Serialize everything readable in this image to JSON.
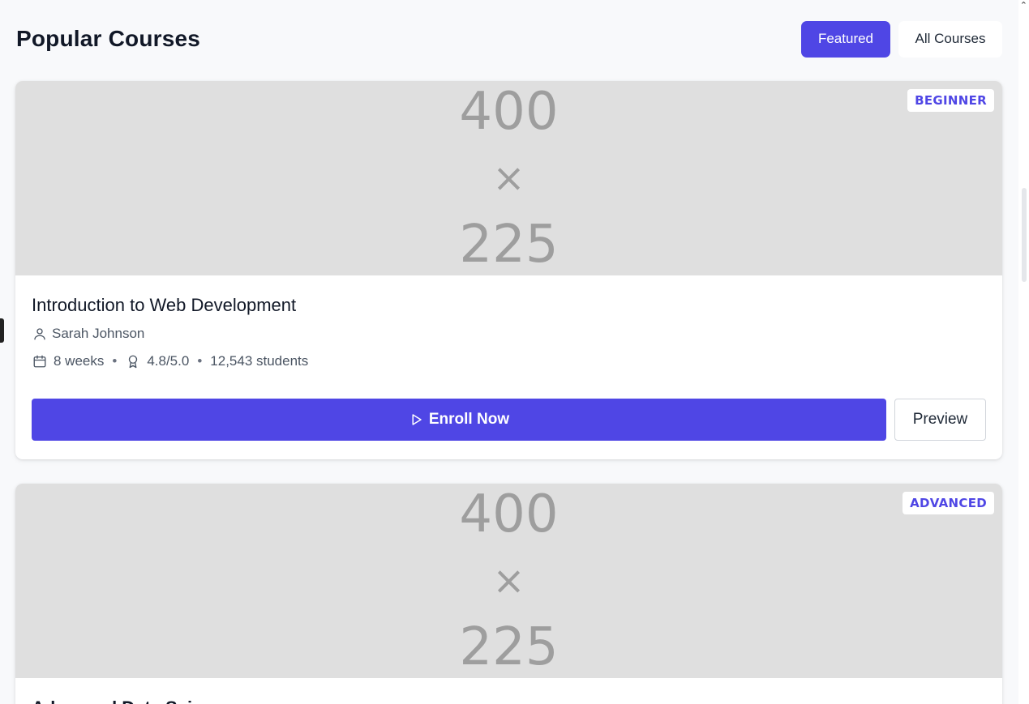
{
  "header": {
    "title": "Popular Courses",
    "filters": [
      {
        "label": "Featured",
        "active": true
      },
      {
        "label": "All Courses",
        "active": false
      }
    ]
  },
  "courses": [
    {
      "thumbnail": {
        "line1": "400",
        "line2": "×",
        "line3": "225"
      },
      "level": "BEGINNER",
      "title": "Introduction to Web Development",
      "instructor": "Sarah Johnson",
      "duration": "8 weeks",
      "rating": "4.8/5.0",
      "students": "12,543 students",
      "enroll_label": "Enroll Now",
      "preview_label": "Preview"
    },
    {
      "thumbnail": {
        "line1": "400",
        "line2": "×",
        "line3": "225"
      },
      "level": "ADVANCED",
      "title": "Advanced Data Science"
    }
  ],
  "colors": {
    "accent": "#4f46e5",
    "background": "#f8f9fb",
    "thumbnail": "#dfdfdf"
  },
  "icons": {
    "instructor": "user-icon",
    "duration": "calendar-icon",
    "rating": "award-icon",
    "enroll": "play-icon"
  }
}
